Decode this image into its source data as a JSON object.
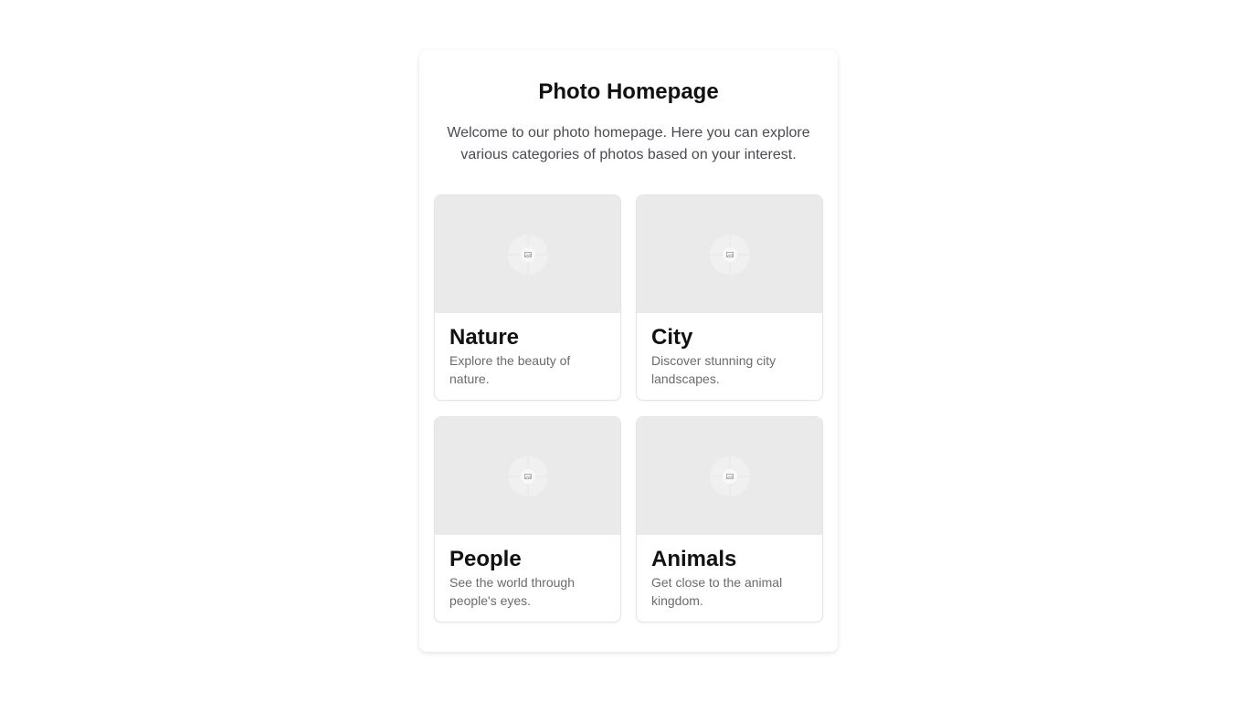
{
  "page": {
    "title": "Photo Homepage",
    "intro": "Welcome to our photo homepage. Here you can explore various categories of photos based on your interest."
  },
  "categories": [
    {
      "title": "Nature",
      "description": "Explore the beauty of nature.",
      "icon": "image-placeholder-icon"
    },
    {
      "title": "City",
      "description": "Discover stunning city landscapes.",
      "icon": "image-placeholder-icon"
    },
    {
      "title": "People",
      "description": "See the world through people's eyes.",
      "icon": "image-placeholder-icon"
    },
    {
      "title": "Animals",
      "description": "Get close to the animal kingdom.",
      "icon": "image-placeholder-icon"
    }
  ],
  "colors": {
    "thumbnail_bg": "#eaeaea",
    "title_text": "#111111",
    "description_text": "#6b6b6b",
    "card_border": "#e5e5e5"
  }
}
